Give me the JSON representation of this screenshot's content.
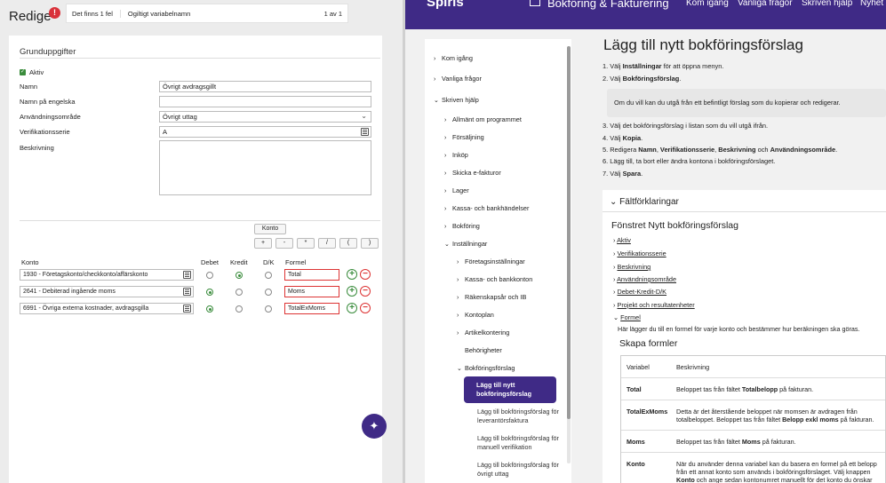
{
  "left": {
    "title": "Redige",
    "error_count_badge": "!",
    "error_bar": {
      "count": "Det finns 1 fel",
      "message": "Ogiltigt variabelnamn",
      "page": "1 av 1"
    },
    "section_title": "Grunduppgifter",
    "aktiv_label": "Aktiv",
    "fields": {
      "namn": {
        "label": "Namn",
        "value": "Övrigt avdragsgillt"
      },
      "namn_en": {
        "label": "Namn på engelska",
        "value": ""
      },
      "omrade": {
        "label": "Användningsområde",
        "value": "Övrigt uttag"
      },
      "serie": {
        "label": "Verifikationsserie",
        "value": "A"
      },
      "beskrivning": {
        "label": "Beskrivning"
      }
    },
    "konto_button": "Konto",
    "operators": [
      "+",
      "-",
      "*",
      "/",
      "(",
      ")"
    ],
    "table_headers": {
      "konto": "Konto",
      "debet": "Debet",
      "kredit": "Kredit",
      "dk": "D/K",
      "formel": "Formel"
    },
    "rows": [
      {
        "konto": "1930 - Företagskonto/checkkonto/affärskonto",
        "selected": "kredit",
        "formel": "Total"
      },
      {
        "konto": "2641 - Debiterad ingående moms",
        "selected": "debet",
        "formel": "Moms"
      },
      {
        "konto": "6991 - Övriga externa kostnader, avdragsgilla",
        "selected": "debet",
        "formel": "TotalExMoms"
      }
    ],
    "plus_label": "+",
    "minus_label": "−"
  },
  "right": {
    "topbar": {
      "logo": "Spiris",
      "section": "Bokföring & Fakturering",
      "nav": [
        "Kom igång",
        "Vanliga frågor",
        "Skriven hjälp",
        "Nyhet"
      ]
    },
    "sidenav": {
      "top_items": [
        "Kom igång",
        "Vanliga frågor",
        "Skriven hjälp"
      ],
      "level1_items": [
        "Allmänt om programmet",
        "Försäljning",
        "Inköp",
        "Skicka e-fakturor",
        "Lager",
        "Kassa- och bankhändelser",
        "Bokföring",
        "Inställningar"
      ],
      "level2_items": [
        "Företagsinställningar",
        "Kassa- och bankkonton",
        "Räkenskapsår och IB",
        "Kontoplan",
        "Artikelkontering",
        "Behörigheter",
        "Bokföringsförslag"
      ],
      "active": "Lägg till nytt bokföringsförslag",
      "sub_items": [
        "Lägg till bokföringsförslag för leverantörsfaktura",
        "Lägg till bokföringsförslag för manuell verifikation",
        "Lägg till bokföringsförslag för övrigt uttag"
      ]
    },
    "heading": "Lägg till nytt bokföringsförslag",
    "steps_a": [
      {
        "pre": "1. Välj ",
        "bold": "Inställningar",
        "post": " för att öppna menyn."
      },
      {
        "pre": "2. Välj ",
        "bold": "Bokföringsförslag",
        "post": "."
      }
    ],
    "note": "Om du vill kan du utgå från ett befintligt förslag som du kopierar och redigerar.",
    "step3": "3. Välj det bokföringsförslag i listan som du vill utgå ifrån.",
    "step4": {
      "pre": "4. Välj ",
      "bold": "Kopia",
      "post": "."
    },
    "step5": {
      "pre": "5. Redigera ",
      "b1": "Namn",
      "s1": ", ",
      "b2": "Verifikationsserie",
      "s2": ", ",
      "b3": "Beskrivning",
      "s3": " och ",
      "b4": "Användningsområde",
      "post": "."
    },
    "step6": "6. Lägg till, ta bort eller ändra kontona i bokföringsförslaget.",
    "step7": {
      "pre": "7. Välj ",
      "bold": "Spara",
      "post": "."
    },
    "falt": {
      "heading": "Fältförklaringar",
      "subheading": "Fönstret Nytt bokföringsförslag",
      "links": [
        "Aktiv",
        "Verifikationsserie",
        "Beskrivning",
        "Användningsområde",
        "Debet-Kredit-D/K",
        "Projekt och resultatenheter",
        "Formel"
      ],
      "formel_desc": "Här lägger du till en formel för varje konto och bestämmer hur beräkningen ska göras.",
      "skapa": "Skapa formler",
      "table": {
        "head": {
          "variabel": "Variabel",
          "beskrivning": "Beskrivning"
        },
        "rows": [
          {
            "variabel": "Total",
            "pre": "Beloppet tas från fältet ",
            "bold": "Totalbelopp",
            "post": " på fakturan."
          },
          {
            "variabel": "TotalExMoms",
            "pre": "Detta är det återstående beloppet när momsen är avdragen från totalbeloppet. Beloppet tas från fältet ",
            "bold": "Belopp exkl moms",
            "post": " på fakturan."
          },
          {
            "variabel": "Moms",
            "pre": "Beloppet tas från fältet ",
            "bold": "Moms",
            "post": " på fakturan."
          },
          {
            "variabel": "Konto",
            "pre": "När du använder denna variabel kan du basera en formel på ett belopp från ett annat konto som används i bokföringsförslaget. Välj knappen ",
            "bold": "Konto",
            "post": " och ange sedan kontonumret manuellt för det konto du önskar ha med i din formel."
          }
        ]
      }
    }
  },
  "colors": {
    "brand": "#3f2a86",
    "accent_green": "#3a8c3c",
    "error_red": "#d9313a"
  }
}
